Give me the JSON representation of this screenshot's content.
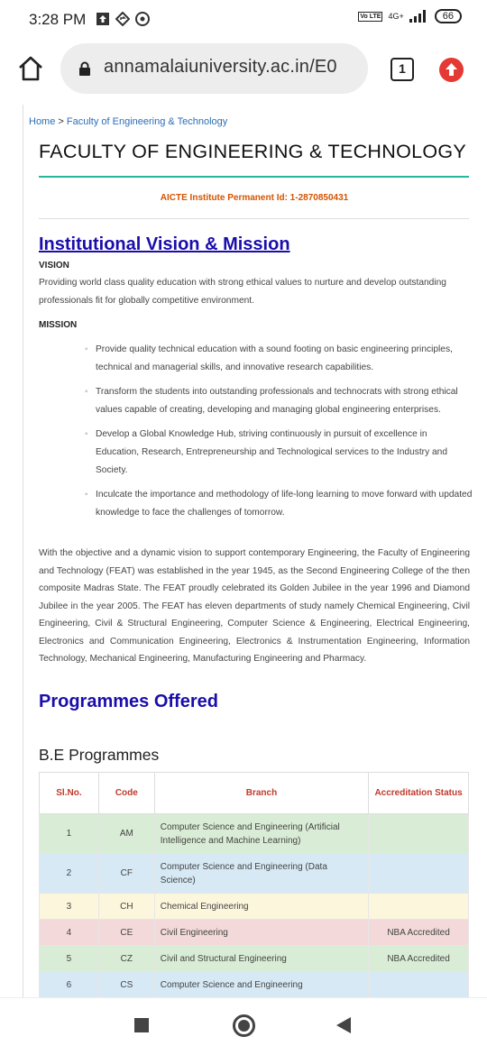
{
  "status_bar": {
    "time": "3:28 PM",
    "volte": "Vo LTE",
    "network": "4G+",
    "battery": "66"
  },
  "browser": {
    "url": "annamalaiuniversity.ac.in/E0",
    "tab_count": "1"
  },
  "page": {
    "breadcrumb": {
      "home": "Home",
      "separator": ">",
      "current": "Faculty of Engineering & Technology"
    },
    "title": "FACULTY OF ENGINEERING & TECHNOLOGY",
    "aicte": "AICTE Institute Permanent Id: 1-2870850431",
    "vision_mission_heading": "Institutional Vision & Mission",
    "vision_label": "VISION",
    "vision_text": "Providing world class quality education with strong ethical values to nurture and develop outstanding professionals fit for globally competitive environment.",
    "mission_label": "MISSION",
    "mission_items": [
      "Provide quality technical education with a sound footing on basic engineering principles, technical and managerial skills, and innovative research capabilities.",
      "Transform the students into outstanding professionals and technocrats with strong ethical values capable of creating, developing and managing global engineering enterprises.",
      "Develop a Global Knowledge Hub, striving continuously in pursuit of excellence in Education, Research, Entrepreneurship and Technological services to the Industry and Society.",
      "Inculcate the importance and methodology of life-long learning to move forward with updated knowledge to face the challenges of tomorrow."
    ],
    "intro": "With the objective and a dynamic vision to support contemporary Engineering, the Faculty of Engineering and Technology (FEAT) was established in the year 1945, as the Second Engineering College of the then composite Madras State. The FEAT proudly celebrated its Golden Jubilee in the year 1996 and Diamond Jubilee in the year 2005. The FEAT has eleven departments of study namely Chemical Engineering, Civil Engineering, Civil & Structural Engineering, Computer Science & Engineering, Electrical Engineering, Electronics and Communication Engineering, Electronics & Instrumentation Engineering, Information Technology, Mechanical Engineering, Manufacturing Engineering  and Pharmacy.",
    "programmes_heading": "Programmes Offered",
    "be_heading": "B.E Programmes",
    "table": {
      "headers": [
        "Sl.No.",
        "Code",
        "Branch",
        "Accreditation Status"
      ],
      "rows": [
        {
          "num": "1",
          "code": "AM",
          "branch": "Computer Science and Engineering (Artificial Intelligence and Machine Learning)",
          "status": "",
          "color": "#d9ecd5"
        },
        {
          "num": "2",
          "code": "CF",
          "branch": "Computer Science and Engineering (Data Science)",
          "status": "",
          "color": "#d6e9f4"
        },
        {
          "num": "3",
          "code": "CH",
          "branch": "Chemical Engineering",
          "status": "",
          "color": "#fcf6dc"
        },
        {
          "num": "4",
          "code": "CE",
          "branch": "Civil Engineering",
          "status": "NBA Accredited",
          "color": "#f3d9d9"
        },
        {
          "num": "5",
          "code": "CZ",
          "branch": "Civil and Structural Engineering",
          "status": "NBA Accredited",
          "color": "#d9ecd5"
        },
        {
          "num": "6",
          "code": "CS",
          "branch": "Computer Science and Engineering",
          "status": "",
          "color": "#d6e9f4"
        }
      ]
    }
  },
  "nav": {
    "recents_icon": "square-icon",
    "home_icon": "circle-icon",
    "back_icon": "triangle-back-icon"
  }
}
